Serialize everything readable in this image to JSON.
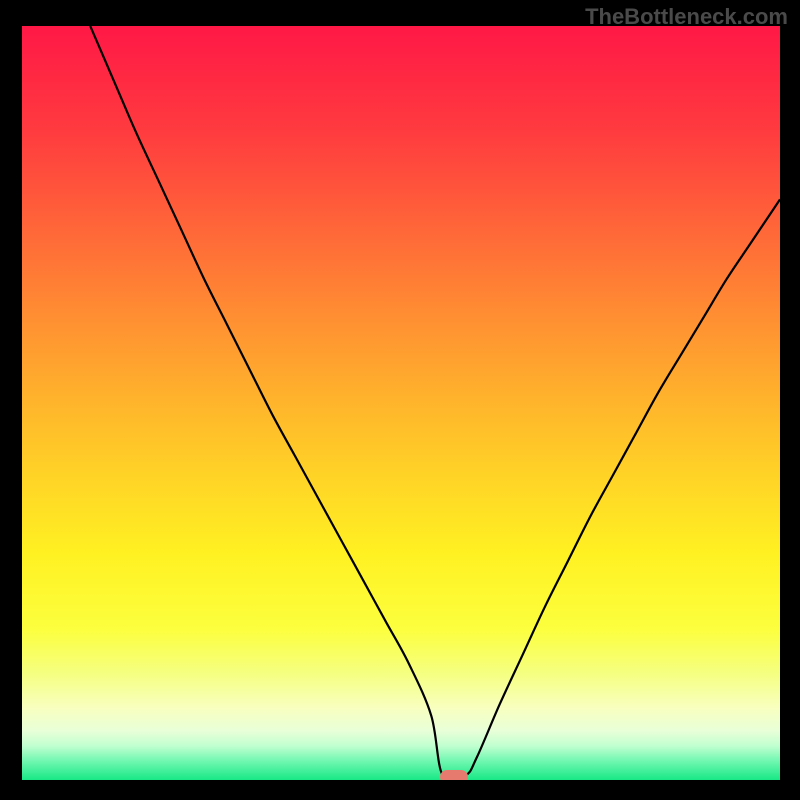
{
  "watermark": "TheBottleneck.com",
  "chart_data": {
    "type": "line",
    "title": "",
    "xlabel": "",
    "ylabel": "",
    "xlim": [
      0,
      100
    ],
    "ylim": [
      0,
      100
    ],
    "grid": false,
    "legend": false,
    "marker": {
      "x": 57,
      "y": 0,
      "color": "#e77a6f"
    },
    "series": [
      {
        "name": "curve",
        "x": [
          9,
          12,
          15,
          18,
          21,
          24,
          27,
          30,
          33,
          36,
          39,
          42,
          45,
          48,
          51,
          54,
          55.5,
          58.5,
          60,
          63,
          66,
          69,
          72,
          75,
          78,
          81,
          84,
          87,
          90,
          93,
          96,
          99,
          100
        ],
        "y": [
          100,
          93,
          86,
          79.5,
          73,
          66.5,
          60.5,
          54.5,
          48.5,
          43,
          37.5,
          32,
          26.5,
          21,
          15.5,
          8.5,
          0.6,
          0.6,
          3,
          10,
          16.5,
          23,
          29,
          35,
          40.5,
          46,
          51.5,
          56.5,
          61.5,
          66.5,
          71,
          75.5,
          77
        ]
      }
    ],
    "background_gradient": {
      "stops": [
        {
          "offset": 0.0,
          "color": "#ff1846"
        },
        {
          "offset": 0.14,
          "color": "#ff3b3f"
        },
        {
          "offset": 0.28,
          "color": "#ff6a38"
        },
        {
          "offset": 0.42,
          "color": "#ff9a30"
        },
        {
          "offset": 0.56,
          "color": "#ffc828"
        },
        {
          "offset": 0.7,
          "color": "#fff122"
        },
        {
          "offset": 0.8,
          "color": "#fcff3e"
        },
        {
          "offset": 0.86,
          "color": "#f5ff82"
        },
        {
          "offset": 0.905,
          "color": "#f8ffc0"
        },
        {
          "offset": 0.935,
          "color": "#e8ffd8"
        },
        {
          "offset": 0.955,
          "color": "#c0ffd0"
        },
        {
          "offset": 0.975,
          "color": "#70f7b0"
        },
        {
          "offset": 1.0,
          "color": "#18e886"
        }
      ]
    }
  }
}
